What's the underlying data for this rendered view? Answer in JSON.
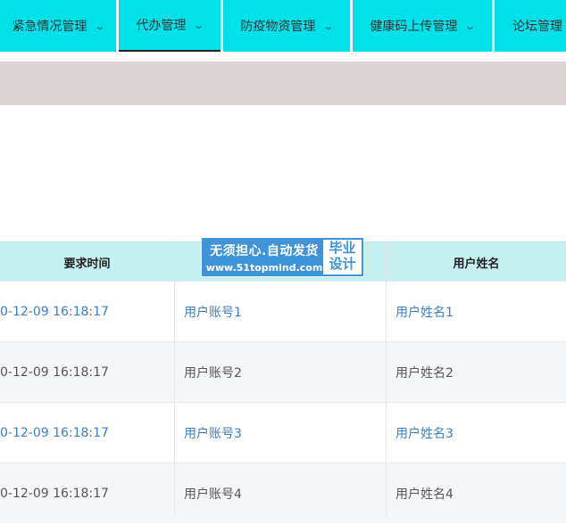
{
  "nav": {
    "items": [
      {
        "label": "紧急情况管理",
        "chevron": "chevron-down-icon"
      },
      {
        "label": "代办管理",
        "chevron": "chevron-down-icon"
      },
      {
        "label": "防疫物资管理",
        "chevron": "chevron-down-icon"
      },
      {
        "label": "健康码上传管理",
        "chevron": "chevron-down-icon"
      },
      {
        "label": "论坛管理"
      }
    ],
    "active_index": 1
  },
  "table": {
    "headers": [
      "要求时间",
      "",
      "用户姓名"
    ],
    "rows": [
      {
        "time": "0-12-09 16:18:17",
        "account": "用户账号1",
        "name": "用户姓名1"
      },
      {
        "time": "0-12-09 16:18:17",
        "account": "用户账号2",
        "name": "用户姓名2"
      },
      {
        "time": "0-12-09 16:18:17",
        "account": "用户账号3",
        "name": "用户姓名3"
      },
      {
        "time": "0-12-09 16:18:17",
        "account": "用户账号4",
        "name": "用户姓名4"
      }
    ]
  },
  "watermark": {
    "line1": "无须担心.自动发货",
    "line2": "www.51topmind.com",
    "box_line1": "毕业",
    "box_line2": "设计"
  },
  "colors": {
    "nav_bg": "#00e1ea",
    "band": "#dcd4d3",
    "header_bg": "#c4f0ef",
    "link": "#3c7fc3",
    "watermark": "#3f93d8"
  }
}
